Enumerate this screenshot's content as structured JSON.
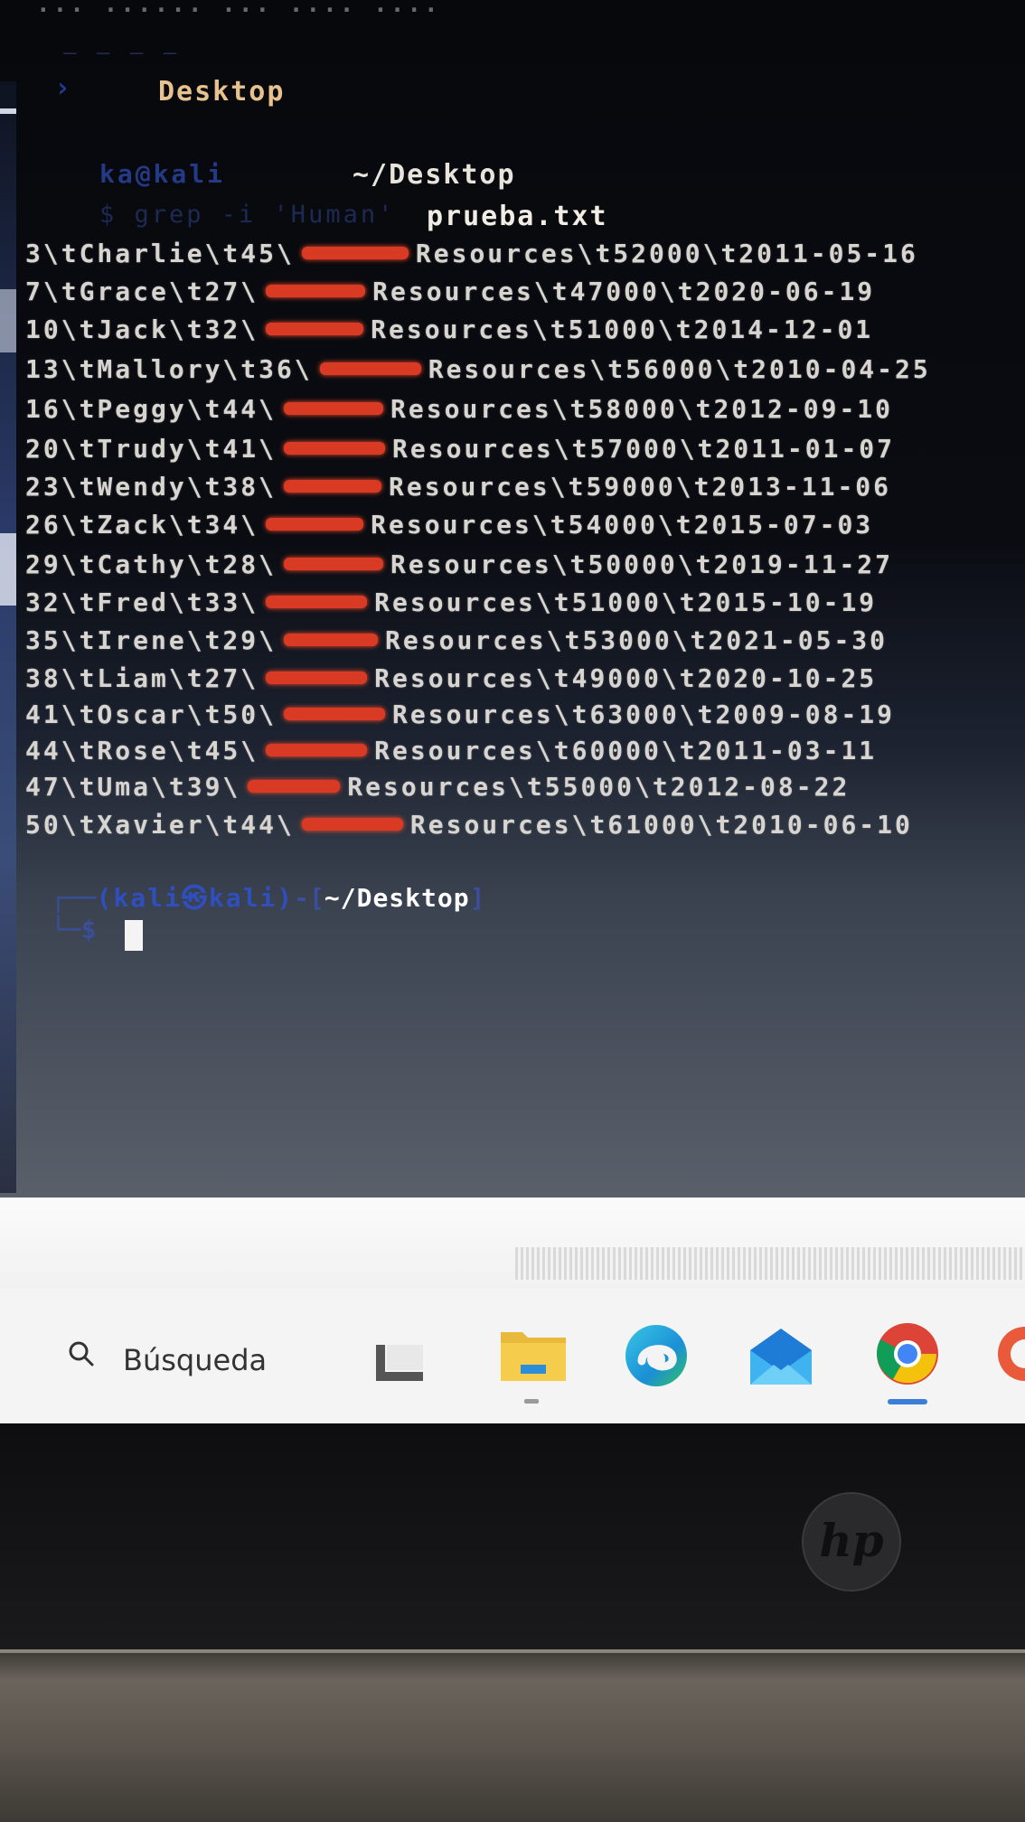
{
  "terminal": {
    "menu_text": "... ...... ... .... ....",
    "tab_title": "Desktop",
    "prompt_user_faint": "ka@kali",
    "prompt_dir": "~/Desktop",
    "command_faint": "$ grep -i 'Human'",
    "command_file": "prueba.txt",
    "rows": [
      {
        "pre": "3\\tCharlie\\t45\\",
        "post": "Resources\\t52000\\t2011-05-16"
      },
      {
        "pre": "7\\tGrace\\t27\\",
        "post": "Resources\\t47000\\t2020-06-19"
      },
      {
        "pre": "10\\tJack\\t32\\",
        "post": "Resources\\t51000\\t2014-12-01"
      },
      {
        "pre": "13\\tMallory\\t36\\",
        "post": "Resources\\t56000\\t2010-04-25"
      },
      {
        "pre": "16\\tPeggy\\t44\\",
        "post": "Resources\\t58000\\t2012-09-10"
      },
      {
        "pre": "20\\tTrudy\\t41\\",
        "post": "Resources\\t57000\\t2011-01-07"
      },
      {
        "pre": "23\\tWendy\\t38\\",
        "post": "Resources\\t59000\\t2013-11-06"
      },
      {
        "pre": "26\\tZack\\t34\\",
        "post": "Resources\\t54000\\t2015-07-03"
      },
      {
        "pre": "29\\tCathy\\t28\\",
        "post": "Resources\\t50000\\t2019-11-27"
      },
      {
        "pre": "32\\tFred\\t33\\",
        "post": "Resources\\t51000\\t2015-10-19"
      },
      {
        "pre": "35\\tIrene\\t29\\",
        "post": "Resources\\t53000\\t2021-05-30"
      },
      {
        "pre": "38\\tLiam\\t27\\",
        "post": "Resources\\t49000\\t2020-10-25"
      },
      {
        "pre": "41\\tOscar\\t50\\",
        "post": "Resources\\t63000\\t2009-08-19"
      },
      {
        "pre": "44\\tRose\\t45\\",
        "post": "Resources\\t60000\\t2011-03-11"
      },
      {
        "pre": "47\\tUma\\t39\\",
        "post": "Resources\\t55000\\t2012-08-22"
      },
      {
        "pre": "50\\tXavier\\t44\\",
        "post": "Resources\\t61000\\t2010-06-10"
      }
    ],
    "prompt2_corner": "┌──",
    "prompt2_user": "(kali㉿kali)",
    "prompt2_sep": "-[",
    "prompt2_dir": "~/Desktop",
    "prompt2_close": "]",
    "prompt2_line2": "└─$"
  },
  "taskbar": {
    "search_label": "Búsqueda",
    "icons": [
      "search-icon",
      "task-view-icon",
      "file-explorer-icon",
      "edge-icon",
      "mail-icon",
      "chrome-icon"
    ]
  },
  "colors": {
    "redaction": "#d83a24",
    "prompt_blue": "#2f4fbf",
    "terminal_text": "#d8d5d0"
  }
}
